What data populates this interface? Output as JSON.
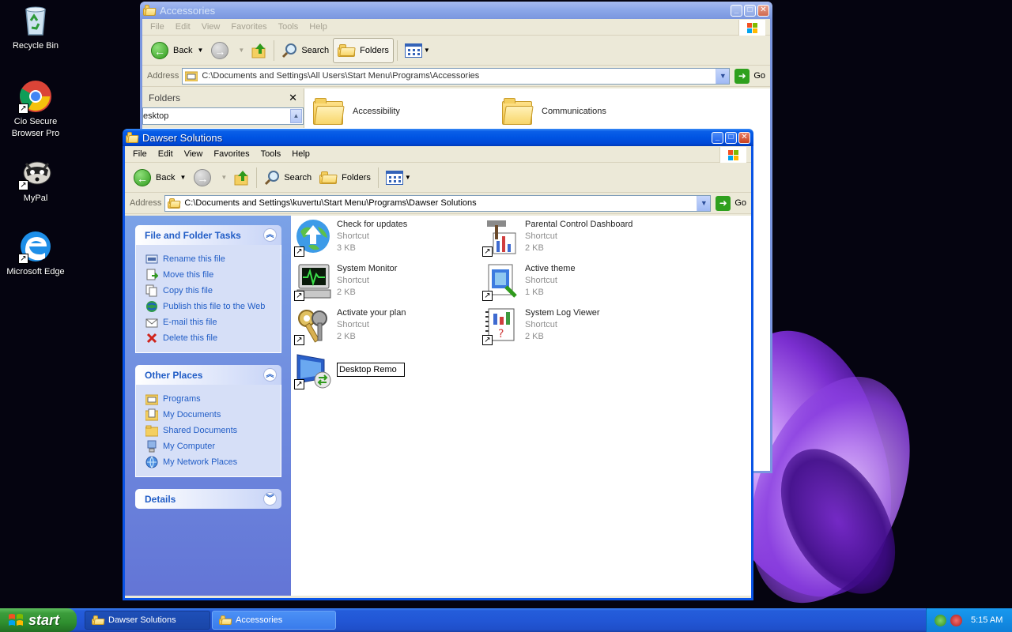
{
  "desktop": {
    "icons": [
      {
        "label": "Recycle Bin"
      },
      {
        "label": "Cio Secure Browser Pro"
      },
      {
        "label": "MyPal"
      },
      {
        "label": "Microsoft Edge"
      }
    ]
  },
  "accessories_window": {
    "title": "Accessories",
    "menu": [
      "File",
      "Edit",
      "View",
      "Favorites",
      "Tools",
      "Help"
    ],
    "toolbar": {
      "back": "Back",
      "search": "Search",
      "folders": "Folders"
    },
    "address_label": "Address",
    "address": "C:\\Documents and Settings\\All Users\\Start Menu\\Programs\\Accessories",
    "go": "Go",
    "folders_pane_title": "Folders",
    "folders_tree_text": "esktop",
    "items": [
      "Accessibility",
      "Communications"
    ]
  },
  "dawser_window": {
    "title": "Dawser Solutions",
    "menu": [
      "File",
      "Edit",
      "View",
      "Favorites",
      "Tools",
      "Help"
    ],
    "toolbar": {
      "back": "Back",
      "search": "Search",
      "folders": "Folders"
    },
    "address_label": "Address",
    "address": "C:\\Documents and Settings\\kuvertu\\Start Menu\\Programs\\Dawser Solutions",
    "go": "Go",
    "file_tasks": {
      "title": "File and Folder Tasks",
      "items": [
        "Rename this file",
        "Move this file",
        "Copy this file",
        "Publish this file to the Web",
        "E-mail this file",
        "Delete this file"
      ]
    },
    "other_places": {
      "title": "Other Places",
      "items": [
        "Programs",
        "My Documents",
        "Shared Documents",
        "My Computer",
        "My Network Places"
      ]
    },
    "details": {
      "title": "Details"
    },
    "files": [
      {
        "name": "Check for updates",
        "type": "Shortcut",
        "size": "3 KB",
        "icon": "update-globe-icon"
      },
      {
        "name": "Parental Control Dashboard",
        "type": "Shortcut",
        "size": "2 KB",
        "icon": "parental-control-icon"
      },
      {
        "name": "System Monitor",
        "type": "Shortcut",
        "size": "2 KB",
        "icon": "system-monitor-icon"
      },
      {
        "name": "Active theme",
        "type": "Shortcut",
        "size": "1 KB",
        "icon": "active-theme-icon"
      },
      {
        "name": "Activate your plan",
        "type": "Shortcut",
        "size": "2 KB",
        "icon": "keys-icon"
      },
      {
        "name": "System Log Viewer",
        "type": "Shortcut",
        "size": "2 KB",
        "icon": "log-viewer-icon"
      }
    ],
    "renaming_file": {
      "value": "Desktop Remo",
      "icon": "remote-desktop-icon"
    }
  },
  "taskbar": {
    "start": "start",
    "tasks": [
      "Dawser Solutions",
      "Accessories"
    ],
    "clock": "5:15 AM"
  },
  "colors": {
    "xp_blue": "#0054e3",
    "task_link": "#215dc6",
    "start_green": "#3c9d3c"
  }
}
